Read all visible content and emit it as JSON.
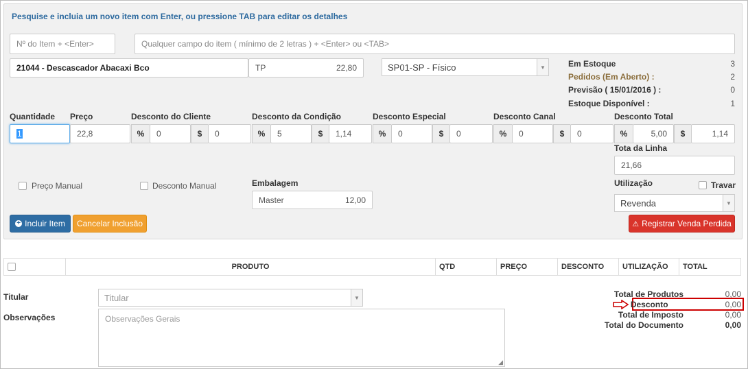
{
  "hint": "Pesquise e incluia um novo item com Enter, ou pressione TAB para editar os detalhes",
  "search": {
    "item_number_placeholder": "Nº do Item + <Enter>",
    "any_field_placeholder": "Qualquer campo do item ( mínimo de 2 letras ) + <Enter> ou <TAB>"
  },
  "item": {
    "name": "21044 - Descascador Abacaxi Bco",
    "price_table": "TP",
    "price_table_value": "22,80",
    "warehouse": "SP01-SP - Físico"
  },
  "stock": [
    {
      "label": "Em Estoque",
      "value": "3",
      "color": "#333333"
    },
    {
      "label": "Pedidos (Em Aberto) :",
      "value": "2",
      "color": "#8a6d3b"
    },
    {
      "label": "Previsão ( 15/01/2016 ) :",
      "value": "0",
      "color": "#333333"
    },
    {
      "label": "Estoque Disponível :",
      "value": "1",
      "color": "#333333"
    }
  ],
  "fields": {
    "quantidade_label": "Quantidade",
    "quantidade": "1",
    "preco_label": "Preço",
    "preco": "22,8",
    "desc_cliente_label": "Desconto do Cliente",
    "desc_cliente_pct": "0",
    "desc_cliente_val": "0",
    "desc_condicao_label": "Desconto da Condição",
    "desc_condicao_pct": "5",
    "desc_condicao_val": "1,14",
    "desc_especial_label": "Desconto Especial",
    "desc_especial_pct": "0",
    "desc_especial_val": "0",
    "desc_canal_label": "Desconto Canal",
    "desc_canal_pct": "0",
    "desc_canal_val": "0",
    "desc_total_label": "Desconto Total",
    "desc_total_pct": "5,00",
    "desc_total_val": "1,14",
    "total_linha_label": "Tota da Linha",
    "total_linha": "21,66",
    "pct_symbol": "%",
    "cur_symbol": "$"
  },
  "options": {
    "preco_manual": "Preço Manual",
    "desconto_manual": "Desconto Manual",
    "embalagem_label": "Embalagem",
    "embalagem": "Master",
    "embalagem_value": "12,00",
    "utilizacao_label": "Utilização",
    "utilizacao": "Revenda",
    "travar": "Travar"
  },
  "buttons": {
    "incluir": "Incluir Item",
    "cancelar": "Cancelar Inclusão",
    "registrar": "Registrar Venda Perdida"
  },
  "table": {
    "columns": [
      "PRODUTO",
      "QTD",
      "PREÇO",
      "DESCONTO",
      "UTILIZAÇÃO",
      "TOTAL"
    ]
  },
  "footer": {
    "titular_label": "Titular",
    "titular_placeholder": "Titular",
    "observacoes_label": "Observações",
    "observacoes_placeholder": "Observações Gerais"
  },
  "totals": [
    {
      "label": "Total de Produtos",
      "value": "0,00"
    },
    {
      "label": "Desconto",
      "value": "0,00"
    },
    {
      "label": "Total de Imposto",
      "value": "0,00"
    },
    {
      "label": "Total do Documento",
      "value": "0,00"
    }
  ],
  "colors": {
    "hint": "#2d6a9f",
    "primary": "#2e6da4",
    "warning": "#f0a030",
    "danger": "#d9342b",
    "highlight": "#cc0000"
  }
}
